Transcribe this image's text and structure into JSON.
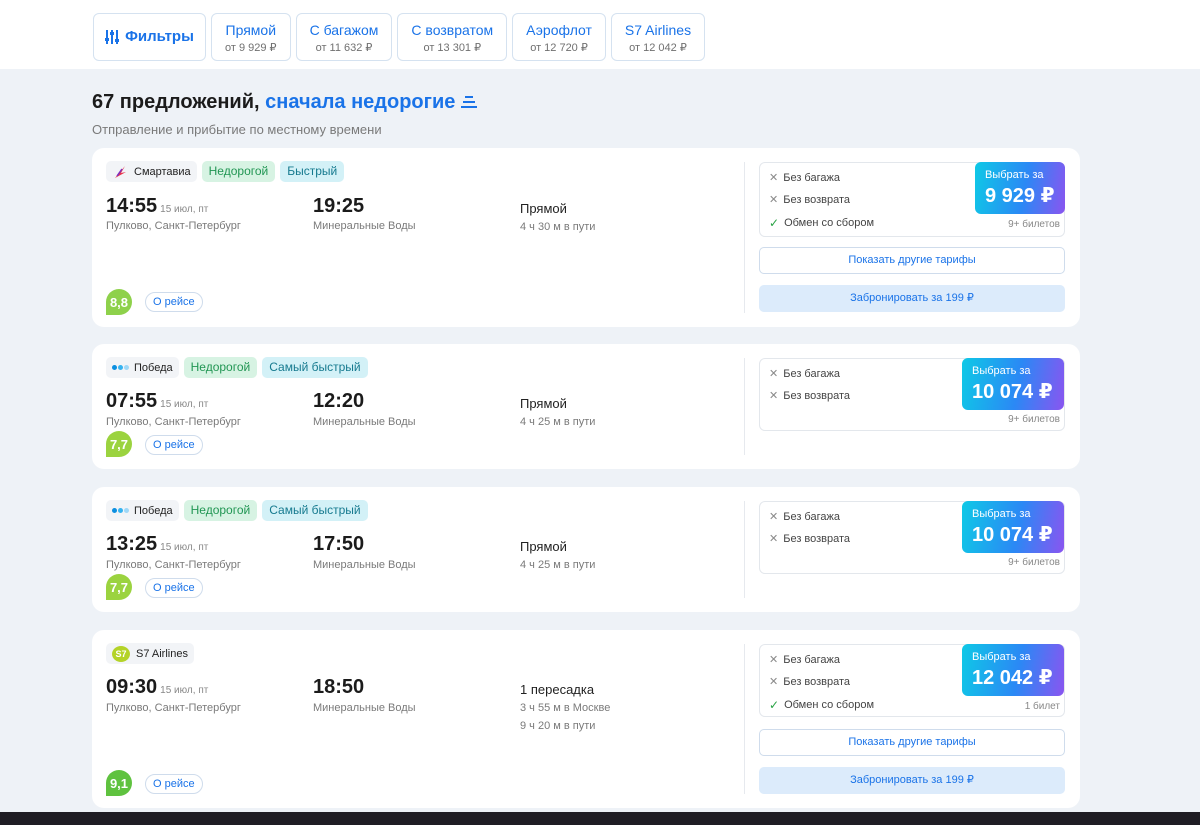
{
  "filters": {
    "main_label": "Фильтры",
    "chips": [
      {
        "title": "Прямой",
        "price": "от 9 929 ₽"
      },
      {
        "title": "С багажом",
        "price": "от 11 632 ₽"
      },
      {
        "title": "С возвратом",
        "price": "от 13 301 ₽"
      },
      {
        "title": "Аэрофлот",
        "price": "от 12 720 ₽"
      },
      {
        "title": "S7 Airlines",
        "price": "от 12 042 ₽"
      }
    ]
  },
  "header": {
    "count": "67 предложений,",
    "sort": "сначала недорогие",
    "subtitle": "Отправление и прибытие по местному времени"
  },
  "common": {
    "about_label": "О рейсе",
    "buy_label": "Выбрать за",
    "tariffs_label": "Показать другие тарифы",
    "book_label": "Забронировать за 199 ₽",
    "no_bag": "Без багажа",
    "no_refund": "Без возврата",
    "exchange": "Обмен со сбором"
  },
  "flights": [
    {
      "airline": "Смартавиа",
      "tags": [
        "Недорогой",
        "Быстрый"
      ],
      "dep_time": "14:55",
      "dep_date": "15 июл, пт",
      "dep_place": "Пулково, Санкт-Петербург",
      "arr_time": "19:25",
      "arr_place": "Минеральные Воды",
      "route": "Прямой",
      "route_sub": [
        "4 ч 30 м в пути"
      ],
      "rating": "8,8",
      "price": "9 929 ₽",
      "tickets": "9+ билетов"
    },
    {
      "airline": "Победа",
      "tags": [
        "Недорогой",
        "Самый быстрый"
      ],
      "dep_time": "07:55",
      "dep_date": "15 июл, пт",
      "dep_place": "Пулково, Санкт-Петербург",
      "arr_time": "12:20",
      "arr_place": "Минеральные Воды",
      "route": "Прямой",
      "route_sub": [
        "4 ч 25 м в пути"
      ],
      "rating": "7,7",
      "price": "10 074 ₽",
      "tickets": "9+ билетов"
    },
    {
      "airline": "Победа",
      "tags": [
        "Недорогой",
        "Самый быстрый"
      ],
      "dep_time": "13:25",
      "dep_date": "15 июл, пт",
      "dep_place": "Пулково, Санкт-Петербург",
      "arr_time": "17:50",
      "arr_place": "Минеральные Воды",
      "route": "Прямой",
      "route_sub": [
        "4 ч 25 м в пути"
      ],
      "rating": "7,7",
      "price": "10 074 ₽",
      "tickets": "9+ билетов"
    },
    {
      "airline": "S7 Airlines",
      "logo_text": "S7",
      "tags": [],
      "dep_time": "09:30",
      "dep_date": "15 июл, пт",
      "dep_place": "Пулково, Санкт-Петербург",
      "arr_time": "18:50",
      "arr_place": "Минеральные Воды",
      "route": "1 пересадка",
      "route_sub": [
        "3 ч 55 м в Москве",
        "9 ч 20 м в пути"
      ],
      "rating": "9,1",
      "price": "12 042 ₽",
      "tickets": "1 билет"
    }
  ],
  "colors": {
    "accent": "#1a73e8",
    "page_bg": "#eef2f7",
    "cheap_tag": "#219653",
    "fast_tag": "#167a8f",
    "pobeda_dots": [
      "#0c8fe0",
      "#36b3f0",
      "#9fd8f7"
    ],
    "smartavia": "#e8354d"
  }
}
